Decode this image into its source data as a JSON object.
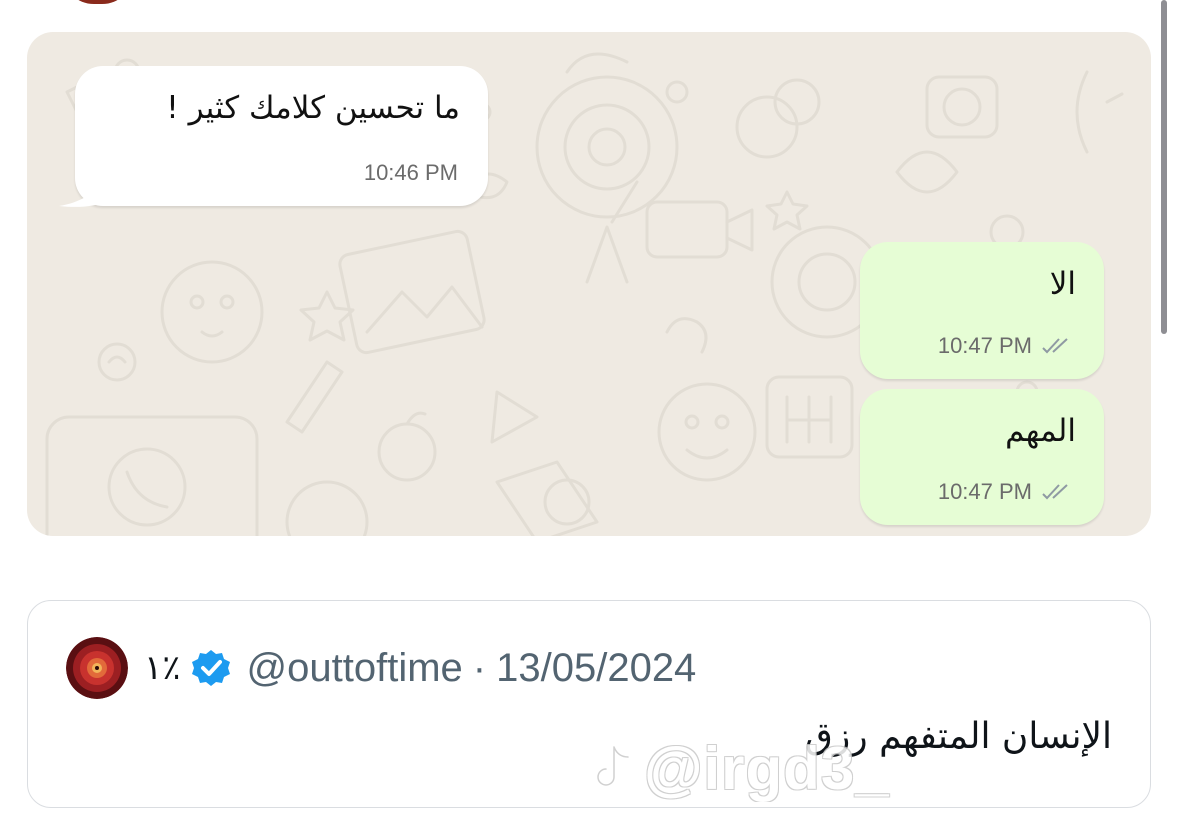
{
  "chat": {
    "messages": [
      {
        "direction": "incoming",
        "text": "ما تحسين كلامك كثير !",
        "time": "10:46 PM"
      },
      {
        "direction": "outgoing",
        "text": "الا",
        "time": "10:47 PM",
        "status_icon": "double-check-icon"
      },
      {
        "direction": "outgoing",
        "text": "المهم",
        "time": "10:47 PM",
        "status_icon": "double-check-icon"
      }
    ]
  },
  "tweet": {
    "display_name": "١٪",
    "verified_icon": "verified-badge-icon",
    "handle": "@outtoftime",
    "separator": "·",
    "date": "13/05/2024",
    "text": "الإنسان المتفهم رزق"
  },
  "watermark": {
    "logo_icon": "tiktok-logo-icon",
    "text": "@irgd3_"
  },
  "colors": {
    "chat_background": "#efeae2",
    "incoming_bubble": "#ffffff",
    "outgoing_bubble": "#e6fdd5",
    "verified_blue": "#1d9bf0",
    "secondary_text": "#536471"
  }
}
